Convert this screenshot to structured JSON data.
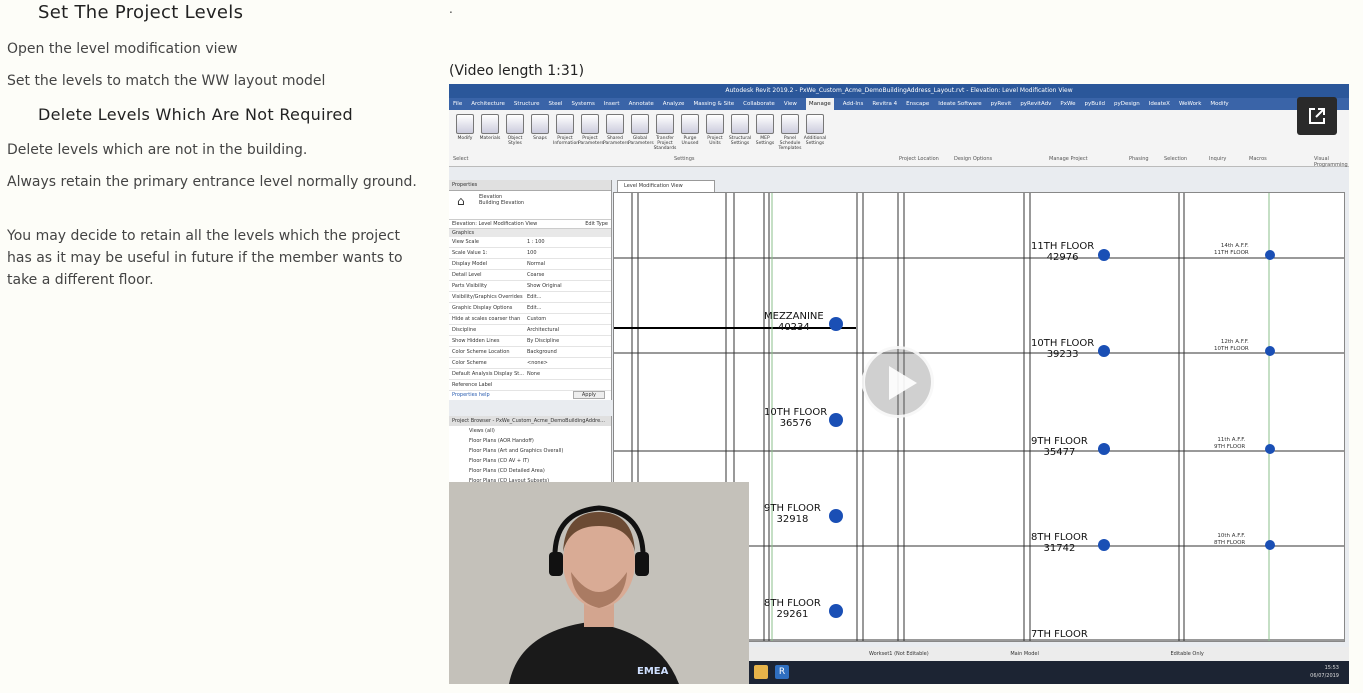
{
  "article": {
    "heading1": "Set The Project Levels",
    "step1": "Open the level modification view",
    "step2": "Set the levels to match the WW layout model",
    "heading2": "Delete Levels Which Are Not Required",
    "para1": "Delete levels which are not in the building.",
    "para2": "Always retain the primary entrance level normally ground.",
    "para3": "You may decide to retain all the levels which the project has as it may be useful in future if the member wants to take a different floor."
  },
  "video": {
    "dot": ".",
    "length_label": "(Video length 1:31)",
    "window_title": "Autodesk Revit 2019.2 - PxWe_Custom_Acme_DemoBuildingAddress_Layout.rvt - Elevation: Level Modification View",
    "ribbon_tabs": [
      "File",
      "Architecture",
      "Structure",
      "Steel",
      "Systems",
      "Insert",
      "Annotate",
      "Analyze",
      "Massing & Site",
      "Collaborate",
      "View",
      "Manage",
      "Add-Ins",
      "Revitra 4",
      "Enscape",
      "Ideate Software",
      "pyRevit",
      "pyRevitAdv",
      "PxWe",
      "pyBuild",
      "pyDesign",
      "IdeateX",
      "WeWork",
      "Modify"
    ],
    "active_tab": "Manage",
    "ribbon_buttons": [
      "Modify",
      "Materials",
      "Object Styles",
      "Snaps",
      "Project Information",
      "Project Parameters",
      "Shared Parameters",
      "Global Parameters",
      "Transfer Project Standards",
      "Purge Unused",
      "Project Units",
      "Structural Settings",
      "MEP Settings",
      "Panel Schedule Templates",
      "Additional Settings"
    ],
    "ribbon_groups": [
      "Select",
      "Settings",
      "Project Location",
      "Design Options",
      "Manage Project",
      "Phasing",
      "Selection",
      "Inquiry",
      "Macros",
      "Visual Programming"
    ],
    "properties": {
      "title": "Properties",
      "type": "Elevation",
      "subtype": "Building Elevation",
      "selector": "Elevation: Level Modification View",
      "edit_type": "Edit Type",
      "section": "Graphics",
      "rows": [
        [
          "View Scale",
          "1 : 100"
        ],
        [
          "Scale Value 1:",
          "100"
        ],
        [
          "Display Model",
          "Normal"
        ],
        [
          "Detail Level",
          "Coarse"
        ],
        [
          "Parts Visibility",
          "Show Original"
        ],
        [
          "Visibility/Graphics Overrides",
          "Edit..."
        ],
        [
          "Graphic Display Options",
          "Edit..."
        ],
        [
          "Hide at scales coarser than",
          "Custom"
        ],
        [
          "Discipline",
          "Architectural"
        ],
        [
          "Show Hidden Lines",
          "By Discipline"
        ],
        [
          "Color Scheme Location",
          "Background"
        ],
        [
          "Color Scheme",
          "<none>"
        ],
        [
          "Default Analysis Display St...",
          "None"
        ],
        [
          "Reference Label",
          ""
        ]
      ],
      "help": "Properties help",
      "apply": "Apply"
    },
    "browser": {
      "title": "Project Browser - PxWe_Custom_Acme_DemoBuildingAddre...",
      "items": [
        "Views (all)",
        "Floor Plans (AOR Handoff)",
        "Floor Plans (Art and Graphics Overall)",
        "Floor Plans (CD AV + IT)",
        "Floor Plans (CD Detailed Area)",
        "Floor Plans (CD Layout Subsets)"
      ]
    },
    "view_tab": "Level Modification View",
    "levels_center": [
      {
        "name": "MEZZANINE",
        "elev": "40234"
      },
      {
        "name": "10TH FLOOR",
        "elev": "36576"
      },
      {
        "name": "9TH FLOOR",
        "elev": "32918"
      },
      {
        "name": "8TH FLOOR",
        "elev": "29261"
      }
    ],
    "levels_right": [
      {
        "name": "11TH FLOOR",
        "elev": "42976"
      },
      {
        "name": "10TH FLOOR",
        "elev": "39233"
      },
      {
        "name": "9TH FLOOR",
        "elev": "35477"
      },
      {
        "name": "8TH FLOOR",
        "elev": "31742"
      },
      {
        "name": "7TH FLOOR",
        "elev": ""
      }
    ],
    "far_right": [
      {
        "a": "14th A.F.F.",
        "b": "11TH FLOOR"
      },
      {
        "a": "12th A.F.F.",
        "b": "10TH FLOOR"
      },
      {
        "a": "11th A.F.F.",
        "b": "9TH FLOOR"
      },
      {
        "a": "10th A.F.F.",
        "b": "8TH FLOOR"
      }
    ],
    "status_workset": "Workset1 (Not Editable)",
    "status_model": "Main Model",
    "status_editable": "Editable Only",
    "clock_time": "15:53",
    "clock_date": "06/07/2019",
    "shirt_text": "EMEA"
  }
}
